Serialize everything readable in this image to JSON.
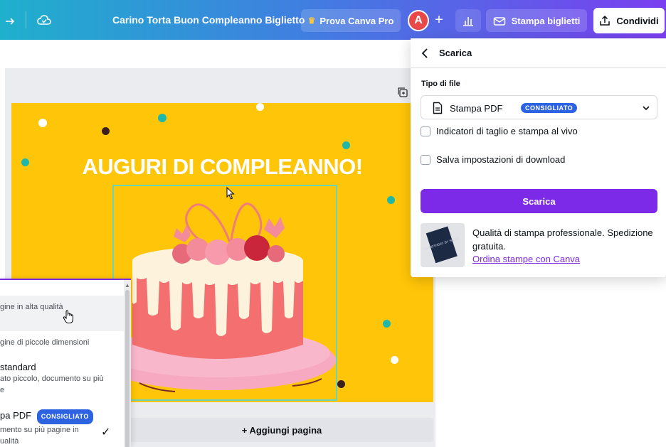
{
  "topbar": {
    "doc_title": "Carino Torta Buon Compleanno Biglietto",
    "pro_label": "Prova Canva Pro",
    "avatar_initial": "A",
    "add_symbol": "+",
    "print_label": "Stampa biglietti",
    "share_label": "Condividi"
  },
  "design": {
    "headline": "AUGURI DI COMPLEANNO!",
    "background_color": "#ffc508"
  },
  "add_page_label": "+ Aggiungi pagina",
  "download_panel": {
    "title": "Scarica",
    "file_type_label": "Tipo di file",
    "selected_type": "Stampa PDF",
    "recommended_badge": "CONSIGLIATO",
    "option_crop_marks": "Indicatori di taglio e stampa al vivo",
    "option_save_settings": "Salva impostazioni di download",
    "download_button": "Scarica",
    "promo_text": "Qualità di stampa professionale. Spedizione gratuita.",
    "promo_link": "Ordina stampe con Canva",
    "promo_card_text": "TO BIRTHDAY BY SO SO"
  },
  "file_type_dropdown": {
    "options": [
      {
        "subtitle": "gine in alta qualità"
      },
      {
        "subtitle": "gine di piccole dimensioni"
      },
      {
        "title": "standard",
        "subtitle_1": "ato piccolo, documento su più",
        "subtitle_2": "e"
      },
      {
        "title": "pa PDF",
        "badge": "CONSIGLIATO",
        "subtitle_1": "mento su più pagine in",
        "subtitle_2": "ualità",
        "check": "✓"
      }
    ]
  },
  "colors": {
    "accent": "#7d2ae8",
    "badge": "#2d63e0",
    "design_bg": "#ffc508",
    "selection": "#6bd3b7"
  }
}
